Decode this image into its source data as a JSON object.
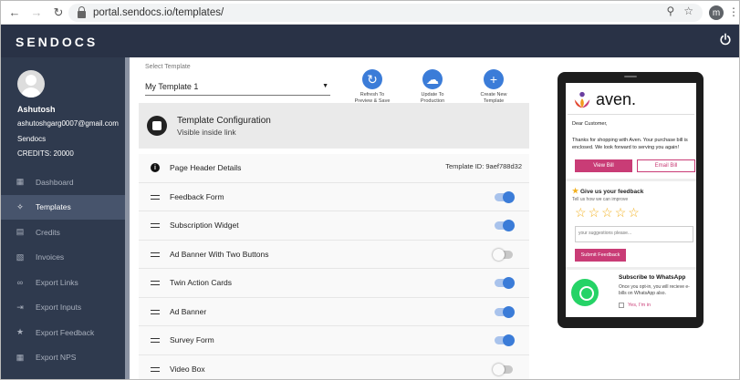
{
  "browser": {
    "url": "portal.sendocs.io/templates/",
    "profile_initial": "m"
  },
  "app": {
    "logo": "SENDOCS"
  },
  "user": {
    "name": "Ashutosh",
    "email": "ashutoshgarg0007@gmail.com",
    "org": "Sendocs",
    "credits": "CREDITS: 20000"
  },
  "nav": {
    "items": [
      {
        "label": "Dashboard",
        "icon": "chart-icon"
      },
      {
        "label": "Templates",
        "icon": "puzzle-icon",
        "active": true
      },
      {
        "label": "Credits",
        "icon": "wallet-icon"
      },
      {
        "label": "Invoices",
        "icon": "invoice-icon"
      },
      {
        "label": "Export Links",
        "icon": "link-icon"
      },
      {
        "label": "Export Inputs",
        "icon": "export-icon"
      },
      {
        "label": "Export Feedback",
        "icon": "star-icon"
      },
      {
        "label": "Export NPS",
        "icon": "chart-icon"
      }
    ]
  },
  "template": {
    "select_label": "Select Template",
    "selected": "My Template 1",
    "actions": [
      {
        "line1": "Refresh To",
        "line2": "Preview & Save"
      },
      {
        "line1": "Update To",
        "line2": "Production"
      },
      {
        "line1": "Create New",
        "line2": "Template"
      }
    ],
    "config_title": "Template Configuration",
    "config_sub": "Visible inside link",
    "header_row": {
      "label": "Page Header Details",
      "template_id": "Template ID: 9aef788d32"
    },
    "sections": [
      {
        "label": "Feedback Form",
        "enabled": true
      },
      {
        "label": "Subscription Widget",
        "enabled": true
      },
      {
        "label": "Ad Banner With Two Buttons",
        "enabled": false
      },
      {
        "label": "Twin Action Cards",
        "enabled": true
      },
      {
        "label": "Ad Banner",
        "enabled": true
      },
      {
        "label": "Survey Form",
        "enabled": true
      },
      {
        "label": "Video Box",
        "enabled": false
      }
    ]
  },
  "preview": {
    "brand": "aven.",
    "greeting": "Dear Customer,",
    "body": "Thanks for shopping with Aven. Your purchase bill is enclosed. We look forward to serving you again!",
    "view_bill": "View Bill",
    "email_bill": "Email Bill",
    "feedback_title": "Give us your feedback",
    "feedback_sub": "Tell us how we can improve",
    "rating_max": 5,
    "suggestion_placeholder": "your suggestions please...",
    "submit_label": "Submit Feedback",
    "wa_title": "Subscribe to WhatsApp",
    "wa_body": "Once you opt-in, you will recieve e-bills on WhatsApp also.",
    "wa_optin": "Yes, I'm in"
  },
  "colors": {
    "header_bg": "#293246",
    "sidebar_bg": "#2f3a4e",
    "accent_blue": "#3b7cd8",
    "brand_pink": "#c93c76",
    "whatsapp_green": "#25d366"
  }
}
